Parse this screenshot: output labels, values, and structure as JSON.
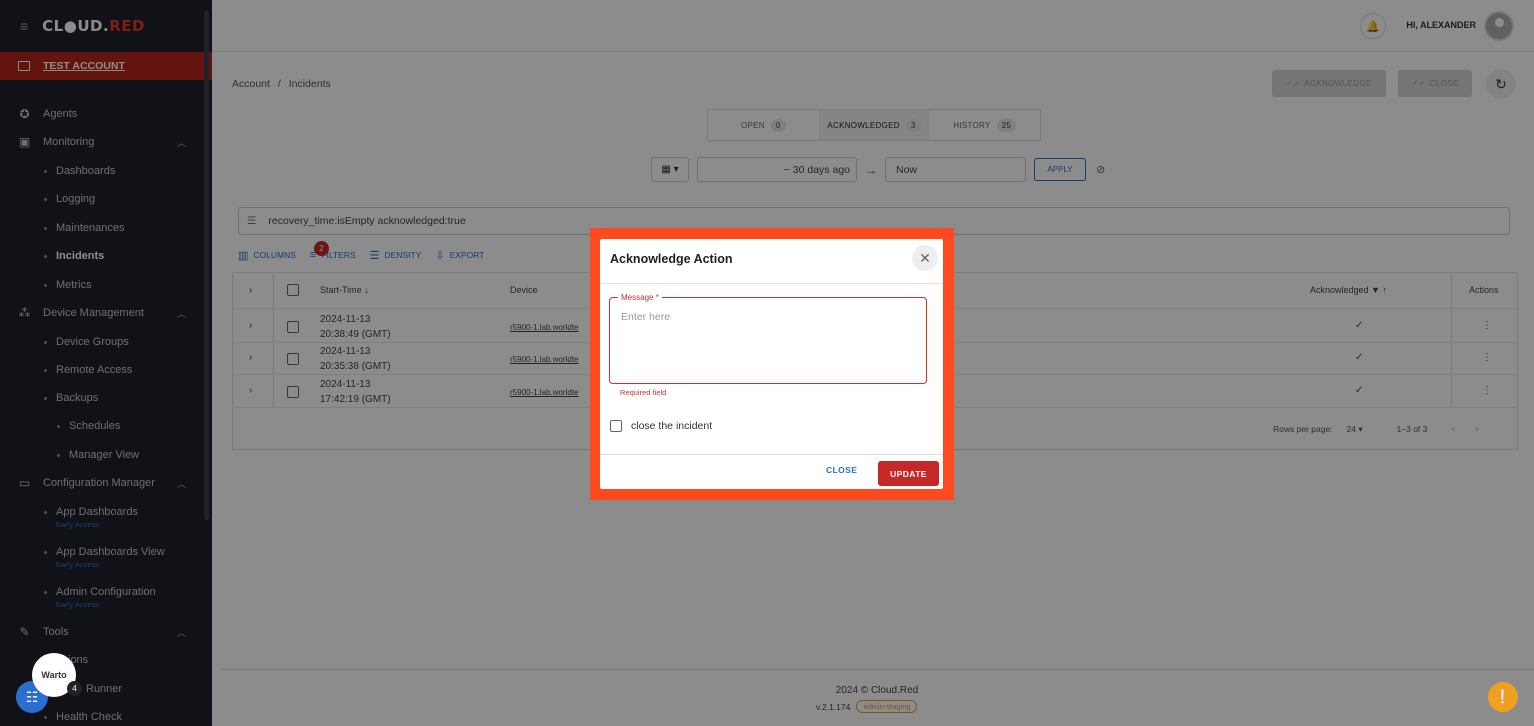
{
  "brand": {
    "logo_a": "CL",
    "logo_o": "●",
    "logo_b": "UD.",
    "logo_red": "RED"
  },
  "account": {
    "name": "TEST ACCOUNT"
  },
  "sidebar": {
    "items": [
      {
        "label": "Agents"
      },
      {
        "label": "Monitoring"
      },
      {
        "label": "Dashboards"
      },
      {
        "label": "Logging"
      },
      {
        "label": "Maintenances"
      },
      {
        "label": "Incidents"
      },
      {
        "label": "Metrics"
      },
      {
        "label": "Device Management"
      },
      {
        "label": "Device Groups"
      },
      {
        "label": "Remote Access"
      },
      {
        "label": "Backups"
      },
      {
        "label": "Schedules"
      },
      {
        "label": "Manager View"
      },
      {
        "label": "Configuration Manager"
      },
      {
        "label": "App Dashboards"
      },
      {
        "label": "App Dashboards View"
      },
      {
        "label": "Admin Configuration"
      },
      {
        "label": "Tools"
      },
      {
        "label": "ions"
      },
      {
        "label": "Runner"
      },
      {
        "label": "Health Check"
      }
    ],
    "early_access": "Early Access"
  },
  "header": {
    "greeting": "HI, ALEXANDER"
  },
  "breadcrumb": {
    "root": "Account",
    "sep": "/",
    "current": "Incidents"
  },
  "actions": {
    "acknowledge": "ACKNOWLEDGE",
    "close": "CLOSE"
  },
  "tabs": [
    {
      "label": "OPEN",
      "count": "0"
    },
    {
      "label": "ACKNOWLEDGED",
      "count": "3"
    },
    {
      "label": "HISTORY",
      "count": "25"
    }
  ],
  "daterange": {
    "from": "~ 30 days ago",
    "to": "Now",
    "apply": "APPLY"
  },
  "filter": {
    "query": "recovery_time:isEmpty acknowledged:true"
  },
  "toolbar": {
    "columns": "COLUMNS",
    "filters": "FILTERS",
    "filters_count": "2",
    "density": "DENSITY",
    "export": "EXPORT"
  },
  "table": {
    "headers": {
      "start": "Start-Time",
      "device": "Device",
      "ack": "Acknowledged",
      "actions": "Actions"
    },
    "rows": [
      {
        "date": "2024-11-13",
        "time": "20:38:49 (GMT)",
        "device": "r5900-1.lab.worldte"
      },
      {
        "date": "2024-11-13",
        "time": "20:35:38 (GMT)",
        "device": "r5900-1.lab.worldte"
      },
      {
        "date": "2024-11-13",
        "time": "17:42:19 (GMT)",
        "device": "r5900-1.lab.worldte"
      }
    ],
    "rows_per_page_label": "Rows per page:",
    "rows_per_page": "24",
    "range": "1–3 of 3"
  },
  "dialog": {
    "title": "Acknowledge Action",
    "message_label": "Message *",
    "message_placeholder": "Enter here",
    "helper": "Required field",
    "checkbox_label": "close the incident",
    "close": "CLOSE",
    "update": "UPDATE"
  },
  "footer": {
    "copyright": "2024  © Cloud.Red",
    "version": "v.2.1.174",
    "env": "admin-staging"
  },
  "widgets": {
    "word": "Warto",
    "badge": "4"
  },
  "colors": {
    "brand_red": "#c62828",
    "accent_blue": "#2a6fd0",
    "dialog_highlight": "#ff4a20"
  }
}
